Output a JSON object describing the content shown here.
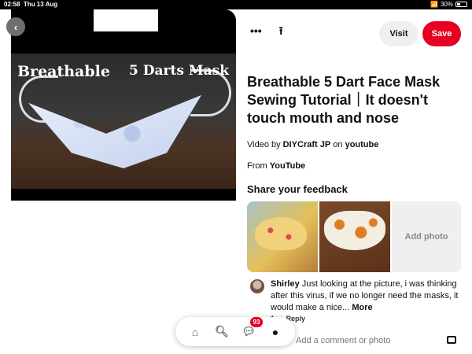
{
  "statusbar": {
    "time": "02:58",
    "date": "Thu 13 Aug",
    "battery": "30%"
  },
  "media": {
    "caption_left": "Breathable",
    "caption_right": "5 Darts Mask"
  },
  "header": {
    "more_icon": "more-icon",
    "share_icon": "share-icon",
    "visit_label": "Visit",
    "save_label": "Save",
    "save_color": "#e60023"
  },
  "pin": {
    "title": "Breathable 5 Dart Face Mask Sewing Tutorial｜It doesn't touch mouth and nose",
    "byline_prefix": "Video by",
    "author": "DIYCraft JP",
    "byline_on": "on",
    "platform": "youtube",
    "from_prefix": "From",
    "source": "YouTube"
  },
  "feedback": {
    "title": "Share your feedback",
    "add_photo_label": "Add photo"
  },
  "comment": {
    "user": "Shirley",
    "text": "Just looking at the picture, i was thinking  after this virus, if we no longer need the masks, it would make a nice...",
    "more_label": "More",
    "reply_prefix": "1 w",
    "reply_label": "Reply"
  },
  "add_comment": {
    "placeholder": "Add a comment or photo"
  },
  "bottom_nav": {
    "items": [
      "home",
      "search",
      "messages",
      "profile"
    ],
    "notification_count": "93"
  }
}
